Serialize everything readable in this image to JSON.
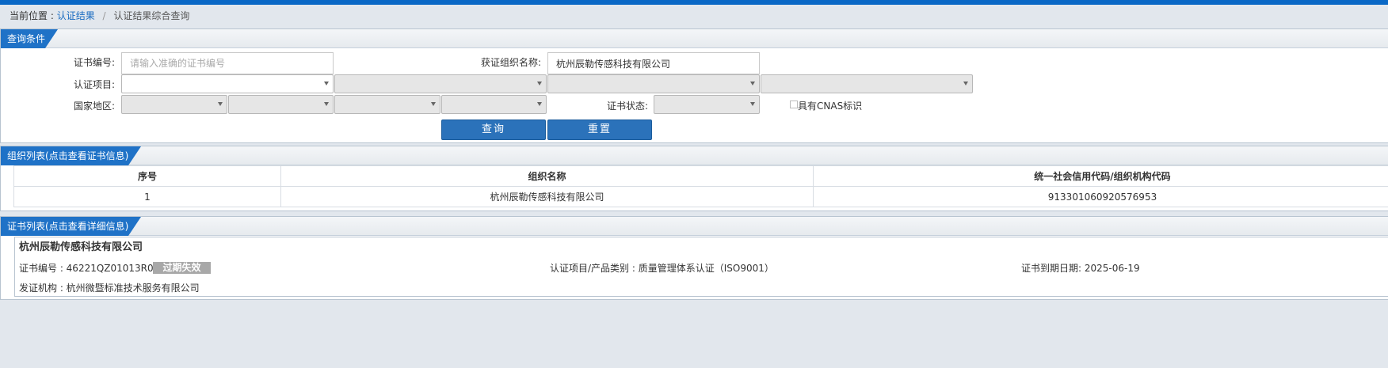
{
  "breadcrumb": {
    "prefix": "当前位置 :",
    "link": "认证结果",
    "sep": "/",
    "current": "认证结果综合查询"
  },
  "query": {
    "title": "查询条件",
    "cert_no_label": "证书编号:",
    "cert_no_placeholder": "请输入准确的证书编号",
    "org_label": "获证组织名称:",
    "org_value": "杭州辰勒传感科技有限公司",
    "project_label": "认证项目:",
    "region_label": "国家地区:",
    "status_label": "证书状态:",
    "cnas_label": "具有CNAS标识",
    "search_btn": "查询",
    "reset_btn": "重置"
  },
  "org_list": {
    "title": "组织列表(点击查看证书信息)",
    "headers": [
      "序号",
      "组织名称",
      "统一社会信用代码/组织机构代码"
    ],
    "rows": [
      [
        "1",
        "杭州辰勒传感科技有限公司",
        "913301060920576953"
      ]
    ]
  },
  "cert_list": {
    "title": "证书列表(点击查看详细信息)",
    "company": "杭州辰勒传感科技有限公司",
    "cert_no": "证书编号 : 46221QZ01013R0S",
    "status": "过期失效",
    "category": "认证项目/产品类别 : 质量管理体系认证（ISO9001）",
    "expiry": "证书到期日期: 2025-06-19",
    "issuer": "发证机构 : 杭州微暨标准技术服务有限公司"
  },
  "colors": {
    "brand": "#0a68c6",
    "button": "#2b72ba",
    "badge": "#a8a8a8"
  }
}
